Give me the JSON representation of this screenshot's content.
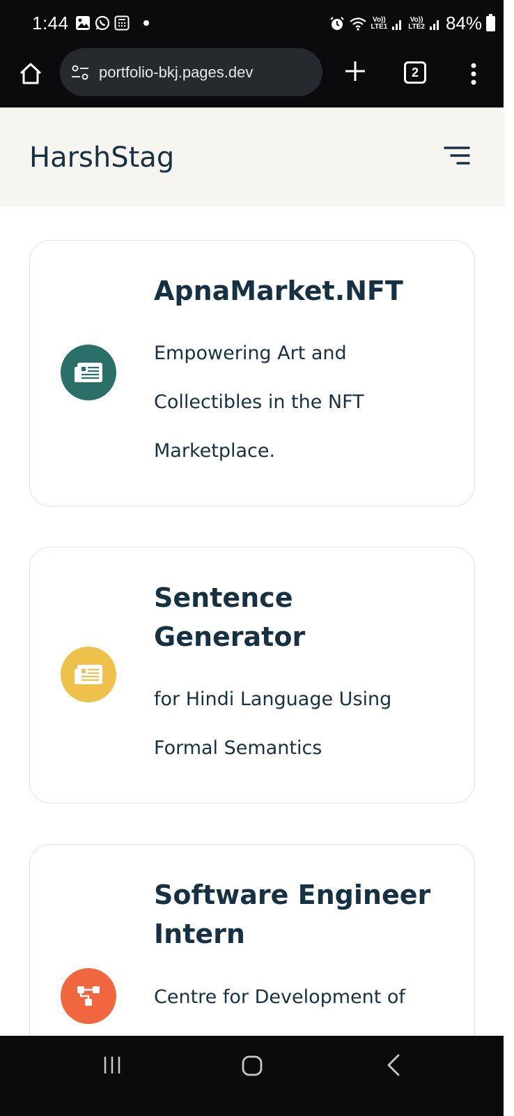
{
  "status_bar": {
    "time": "1:44",
    "left_icons": [
      "gallery-icon",
      "whatsapp-icon",
      "calculator-icon"
    ],
    "net1_top": "Vo))",
    "net1_bottom": "LTE1",
    "net2_top": "Vo))",
    "net2_bottom": "LTE2",
    "battery": "84%"
  },
  "browser": {
    "url": "portfolio-bkj.pages.dev",
    "tab_count": "2"
  },
  "site": {
    "brand": "HarshStag"
  },
  "cards": [
    {
      "title": "ApnaMarket.NFT",
      "lines": [
        "Empowering Art and",
        "Collectibles in the NFT",
        "Marketplace."
      ],
      "icon": "newspaper-icon",
      "icon_color": "#2a7069"
    },
    {
      "title_lines": [
        "Sentence",
        "Generator"
      ],
      "lines": [
        "for Hindi Language Using",
        "Formal Semantics"
      ],
      "icon": "newspaper-icon",
      "icon_color": "#eec14a"
    },
    {
      "title_lines": [
        "Software Engineer",
        "Intern"
      ],
      "lines": [
        "Centre for Development of"
      ],
      "icon": "sitemap-icon",
      "icon_color": "#f0673f"
    }
  ],
  "colors": {
    "heading": "#163044",
    "header_bg": "#f7f5f0",
    "system_bg": "#0b0b0d"
  }
}
